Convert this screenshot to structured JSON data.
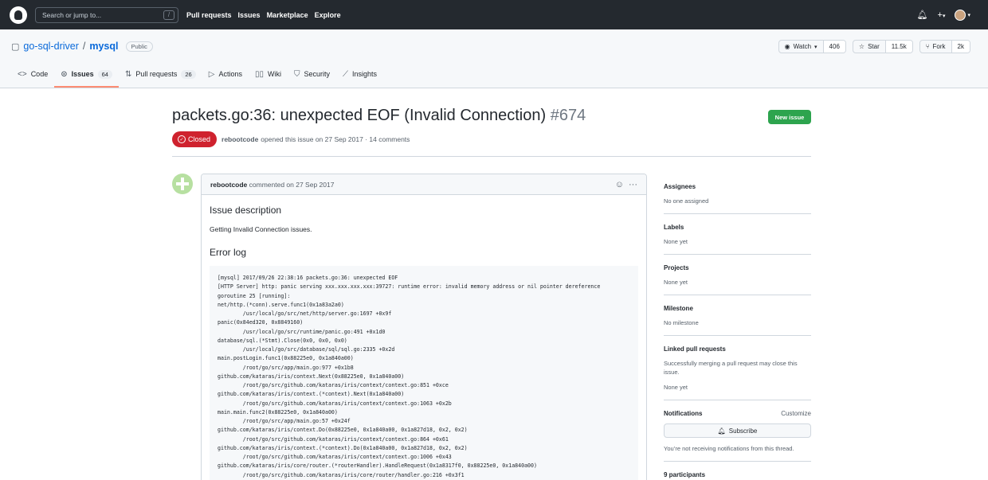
{
  "header": {
    "search_placeholder": "Search or jump to...",
    "search_key": "/",
    "nav": [
      "Pull requests",
      "Issues",
      "Marketplace",
      "Explore"
    ]
  },
  "repo": {
    "owner": "go-sql-driver",
    "separator": "/",
    "name": "mysql",
    "visibility": "Public",
    "watch_label": "Watch",
    "watch_count": "406",
    "star_label": "Star",
    "star_count": "11.5k",
    "fork_label": "Fork",
    "fork_count": "2k",
    "tabs": [
      {
        "label": "Code",
        "count": ""
      },
      {
        "label": "Issues",
        "count": "64"
      },
      {
        "label": "Pull requests",
        "count": "26"
      },
      {
        "label": "Actions",
        "count": ""
      },
      {
        "label": "Wiki",
        "count": ""
      },
      {
        "label": "Security",
        "count": ""
      },
      {
        "label": "Insights",
        "count": ""
      }
    ]
  },
  "issue": {
    "title": "packets.go:36: unexpected EOF (Invalid Connection)",
    "number": "#674",
    "new_issue_label": "New issue",
    "state": "Closed",
    "author": "rebootcode",
    "meta_text": "opened this issue on 27 Sep 2017 · 14 comments"
  },
  "comment": {
    "author": "rebootcode",
    "meta": "commented on 27 Sep 2017",
    "heading_desc": "Issue description",
    "desc_text": "Getting Invalid Connection issues.",
    "heading_log": "Error log",
    "log": "[mysql] 2017/09/26 22:38:16 packets.go:36: unexpected EOF\n[HTTP Server] http: panic serving xxx.xxx.xxx.xxx:39727: runtime error: invalid memory address or nil pointer dereference\ngoroutine 25 [running]:\nnet/http.(*conn).serve.func1(0x1a83a2a0)\n        /usr/local/go/src/net/http/server.go:1697 +0x9f\npanic(0x84ed320, 0x8849160)\n        /usr/local/go/src/runtime/panic.go:491 +0x1d0\ndatabase/sql.(*Stmt).Close(0x0, 0x0, 0x0)\n        /usr/local/go/src/database/sql/sql.go:2335 +0x2d\nmain.postLogin.func1(0x88225e0, 0x1a840a00)\n        /root/go/src/app/main.go:977 +0x1b8\ngithub.com/kataras/iris/context.Next(0x88225e0, 0x1a840a00)\n        /root/go/src/github.com/kataras/iris/context/context.go:851 +0xce\ngithub.com/kataras/iris/context.(*context).Next(0x1a840a00)\n        /root/go/src/github.com/kataras/iris/context/context.go:1063 +0x2b\nmain.main.func2(0x88225e0, 0x1a840a00)\n        /root/go/src/app/main.go:57 +0x24f\ngithub.com/kataras/iris/context.Do(0x88225e0, 0x1a840a00, 0x1a827d18, 0x2, 0x2)\n        /root/go/src/github.com/kataras/iris/context/context.go:864 +0x61\ngithub.com/kataras/iris/context.(*context).Do(0x1a840a00, 0x1a827d18, 0x2, 0x2)\n        /root/go/src/github.com/kataras/iris/context/context.go:1006 +0x43\ngithub.com/kataras/iris/core/router.(*routerHandler).HandleRequest(0x1a8317f0, 0x88225e0, 0x1a840a00)\n        /root/go/src/github.com/kataras/iris/core/router/handler.go:216 +0x3f1"
  },
  "sidebar": {
    "assignees_title": "Assignees",
    "assignees_value": "No one assigned",
    "labels_title": "Labels",
    "labels_value": "None yet",
    "projects_title": "Projects",
    "projects_value": "None yet",
    "milestone_title": "Milestone",
    "milestone_value": "No milestone",
    "linked_title": "Linked pull requests",
    "linked_text": "Successfully merging a pull request may close this issue.",
    "linked_value": "None yet",
    "notifications_title": "Notifications",
    "customize_label": "Customize",
    "subscribe_label": "Subscribe",
    "notif_text": "You’re not receiving notifications from this thread.",
    "participants": "9 participants"
  }
}
